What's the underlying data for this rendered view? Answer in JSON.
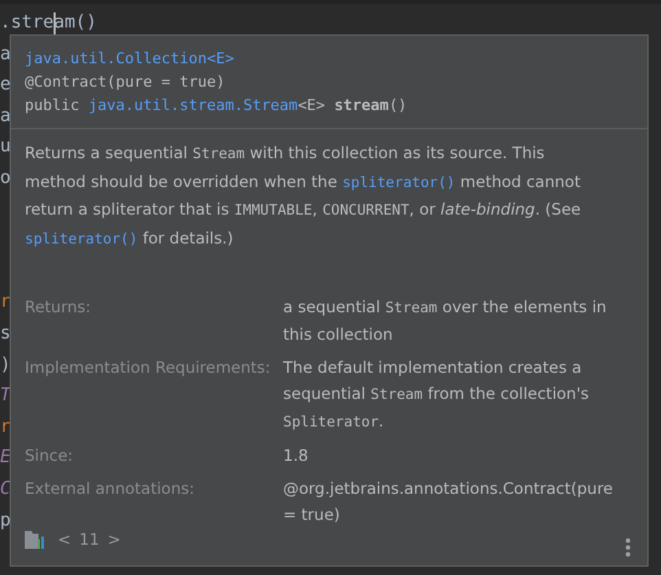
{
  "editor": {
    "lines": [
      {
        "kind": "caret",
        "before": ".stre",
        "after": "am()"
      },
      {
        "kind": "plain",
        "text": "a"
      },
      {
        "kind": "plain",
        "text": "e"
      },
      {
        "kind": "plain",
        "text": "a"
      },
      {
        "kind": "plain",
        "text": "u"
      },
      {
        "kind": "plain",
        "text": "o"
      },
      {
        "kind": "blank"
      },
      {
        "kind": "blank"
      },
      {
        "kind": "blank"
      },
      {
        "kind": "keyword",
        "text": "r"
      },
      {
        "kind": "plain",
        "text": "s"
      },
      {
        "kind": "plain",
        "text": ")"
      },
      {
        "kind": "type",
        "text": "T"
      },
      {
        "kind": "keyword",
        "text": "r"
      },
      {
        "kind": "type",
        "text": "E"
      },
      {
        "kind": "type",
        "text": "C"
      },
      {
        "kind": "plain",
        "text": "p"
      }
    ]
  },
  "doc_popup": {
    "signature": [
      [
        {
          "kind": "link",
          "text": "java.util.Collection<E>"
        }
      ],
      [
        {
          "kind": "text",
          "text": "@Contract(pure = true)"
        }
      ],
      [
        {
          "kind": "text",
          "text": "public "
        },
        {
          "kind": "link",
          "text": "java.util.stream.Stream"
        },
        {
          "kind": "text",
          "text": "<E> "
        },
        {
          "kind": "bold",
          "text": "stream"
        },
        {
          "kind": "text",
          "text": "()"
        }
      ]
    ],
    "description": [
      {
        "kind": "text",
        "text": "Returns a sequential "
      },
      {
        "kind": "code",
        "text": "Stream"
      },
      {
        "kind": "text",
        "text": " with this collection as its source. This method should be overridden when the "
      },
      {
        "kind": "link",
        "text": "spliterator()"
      },
      {
        "kind": "text",
        "text": " method cannot return a spliterator that is "
      },
      {
        "kind": "code",
        "text": "IMMUTABLE"
      },
      {
        "kind": "text",
        "text": ", "
      },
      {
        "kind": "code",
        "text": "CONCURRENT"
      },
      {
        "kind": "text",
        "text": ", or "
      },
      {
        "kind": "italic",
        "text": "late-binding"
      },
      {
        "kind": "text",
        "text": ". (See "
      },
      {
        "kind": "link",
        "text": "spliterator()"
      },
      {
        "kind": "text",
        "text": " for details.)"
      }
    ],
    "sections": [
      {
        "label": "Returns:",
        "value": [
          {
            "kind": "text",
            "text": "a sequential "
          },
          {
            "kind": "code",
            "text": "Stream"
          },
          {
            "kind": "text",
            "text": " over the elements in this collection"
          }
        ]
      },
      {
        "label": "Implementation Requirements:",
        "value": [
          {
            "kind": "text",
            "text": "The default implementation creates a sequential "
          },
          {
            "kind": "code",
            "text": "Stream"
          },
          {
            "kind": "text",
            "text": " from the collection's "
          },
          {
            "kind": "code",
            "text": "Spliterator"
          },
          {
            "kind": "text",
            "text": "."
          }
        ]
      },
      {
        "label": "Since:",
        "value": [
          {
            "kind": "text",
            "text": "1.8"
          }
        ]
      },
      {
        "label": "External annotations:",
        "value": [
          {
            "kind": "text",
            "text": "@org.jetbrains.annotations.Contract(pure = true)"
          }
        ]
      }
    ],
    "footer": {
      "prev": "<",
      "version": "11",
      "next": ">"
    }
  }
}
